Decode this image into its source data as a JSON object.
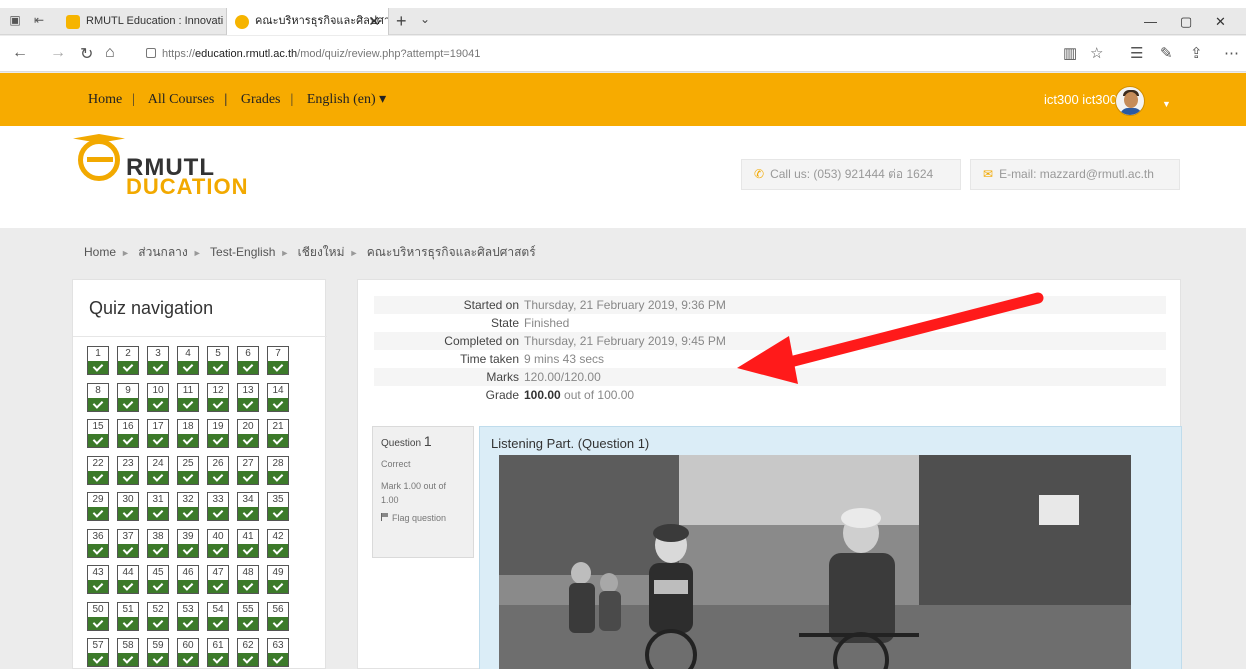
{
  "browser": {
    "tabs": [
      {
        "title": "RMUTL Education : Innovati",
        "active": false
      },
      {
        "title": "คณะบริหารธุรกิจและศิลปศา",
        "active": true
      }
    ],
    "url_prefix": "https://",
    "url_host": "education.rmutl.ac.th",
    "url_path": "/mod/quiz/review.php?attempt=19041"
  },
  "nav": {
    "items": [
      "Home",
      "All Courses",
      "Grades",
      "English (en) ▾"
    ],
    "user_name": "ict300 ict300"
  },
  "header": {
    "logo_top": "RMUTL",
    "logo_bottom": "DUCATION",
    "phone": "Call us: (053) 921444 ต่อ 1624",
    "email": "E-mail: mazzard@rmutl.ac.th"
  },
  "breadcrumb": [
    "Home",
    "ส่วนกลาง",
    "Test-English",
    "เชียงใหม่",
    "คณะบริหารธุรกิจและศิลปศาสตร์"
  ],
  "quiz_nav": {
    "title": "Quiz navigation",
    "buttons": [
      "1",
      "2",
      "3",
      "4",
      "5",
      "6",
      "7",
      "8",
      "9",
      "10",
      "11",
      "12",
      "13",
      "14",
      "15",
      "16",
      "17",
      "18",
      "19",
      "20",
      "21",
      "22",
      "23",
      "24",
      "25",
      "26",
      "27",
      "28",
      "29",
      "30",
      "31",
      "32",
      "33",
      "34",
      "35",
      "36",
      "37",
      "38",
      "39",
      "40",
      "41",
      "42",
      "43",
      "44",
      "45",
      "46",
      "47",
      "48",
      "49",
      "50",
      "51",
      "52",
      "53",
      "54",
      "55",
      "56",
      "57",
      "58",
      "59",
      "60",
      "61",
      "62",
      "63"
    ]
  },
  "summary": [
    {
      "label": "Started on",
      "value": "Thursday, 21 February 2019, 9:36 PM"
    },
    {
      "label": "State",
      "value": "Finished"
    },
    {
      "label": "Completed on",
      "value": "Thursday, 21 February 2019, 9:45 PM"
    },
    {
      "label": "Time taken",
      "value": "9 mins 43 secs"
    },
    {
      "label": "Marks",
      "value": "120.00/120.00"
    },
    {
      "label": "Grade",
      "value_bold": "100.00",
      "value": " out of 100.00"
    }
  ],
  "question": {
    "label": "Question",
    "number": "1",
    "status": "Correct",
    "mark": "Mark 1.00 out of 1.00",
    "flag": "Flag question",
    "text": "Listening Part. (Question 1)"
  },
  "colors": {
    "accent": "#f7ab00",
    "correct": "#3c7a2a",
    "question_bg": "#dbedf7",
    "arrow": "#ff1a1a"
  }
}
